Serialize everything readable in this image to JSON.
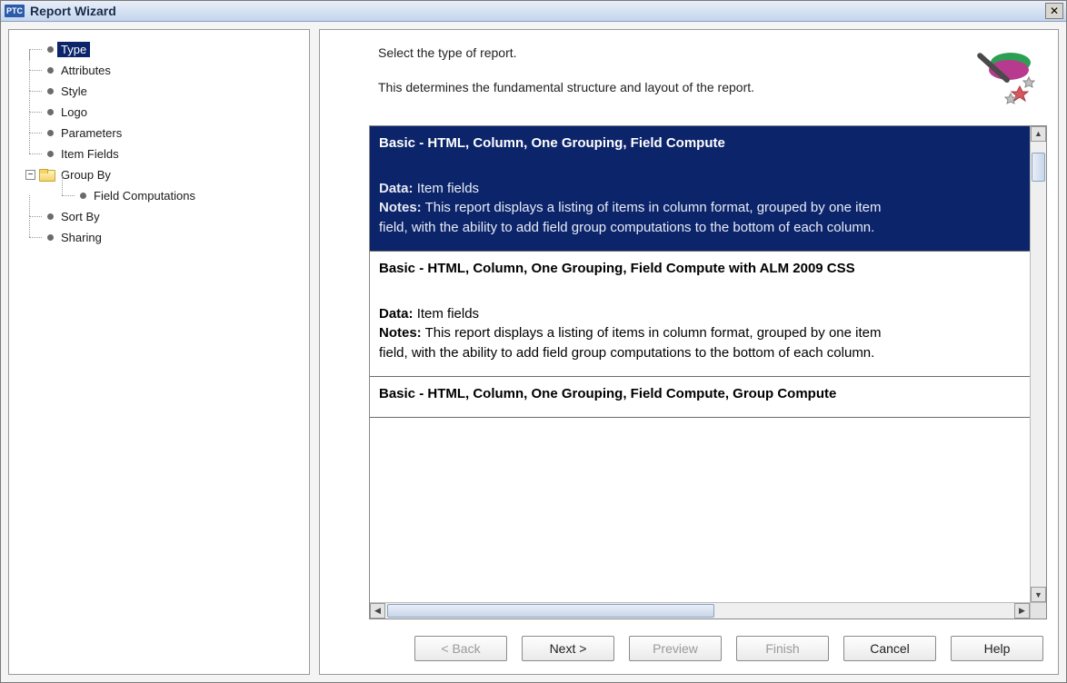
{
  "window": {
    "logo_text": "PTC",
    "title": "Report Wizard",
    "close_glyph": "✕"
  },
  "tree": {
    "items": [
      {
        "label": "Type",
        "selected": true
      },
      {
        "label": "Attributes"
      },
      {
        "label": "Style"
      },
      {
        "label": "Logo"
      },
      {
        "label": "Parameters"
      },
      {
        "label": "Item Fields"
      },
      {
        "label": "Group By",
        "folder": true,
        "expanded": true,
        "children": [
          {
            "label": "Field Computations"
          }
        ]
      },
      {
        "label": "Sort By"
      },
      {
        "label": "Sharing"
      }
    ],
    "expander_glyph": "−"
  },
  "header": {
    "line1": "Select the type of report.",
    "line2": "This determines the fundamental structure and layout of the report."
  },
  "report_types": [
    {
      "title": "Basic - HTML, Column, One Grouping, Field Compute",
      "data_label": "Data:",
      "data_value": "Item fields",
      "notes_label": "Notes:",
      "notes_value": "This report displays a listing of items in column format, grouped by one item field, with the ability to add field group computations to the bottom of each column.",
      "selected": true
    },
    {
      "title": "Basic - HTML, Column, One Grouping, Field Compute with ALM 2009 CSS",
      "data_label": "Data:",
      "data_value": "Item fields",
      "notes_label": "Notes:",
      "notes_value": "This report displays a listing of items in column format, grouped by one item field, with the ability to add field group computations to the bottom of each column.",
      "selected": false
    },
    {
      "title": "Basic - HTML, Column, One Grouping, Field Compute, Group Compute",
      "compact": true
    }
  ],
  "scroll": {
    "up": "▲",
    "down": "▼",
    "left": "◀",
    "right": "▶"
  },
  "buttons": {
    "back": "< Back",
    "next": "Next >",
    "preview": "Preview",
    "finish": "Finish",
    "cancel": "Cancel",
    "help": "Help"
  }
}
